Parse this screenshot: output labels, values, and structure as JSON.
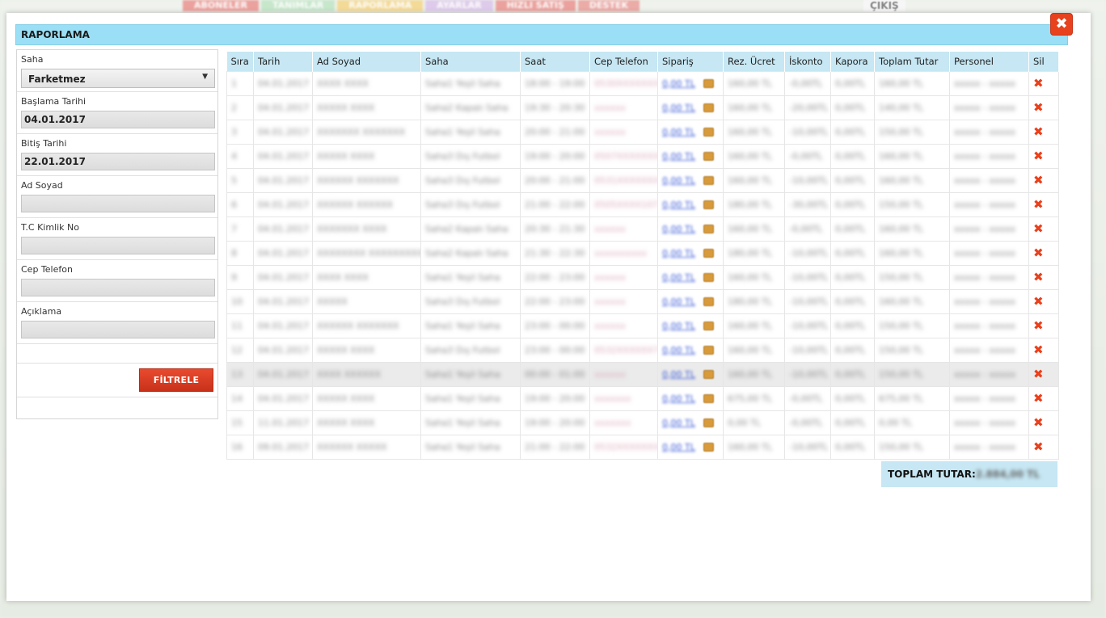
{
  "background_nav": {
    "items": [
      {
        "label": "ABONELER",
        "color": "#e05b56"
      },
      {
        "label": "TANIMLAR",
        "color": "#9fd7a8"
      },
      {
        "label": "RAPORLAMA",
        "color": "#f0c04a"
      },
      {
        "label": "AYARLAR",
        "color": "#c9a6e0"
      },
      {
        "label": "HIZLI SATIŞ",
        "color": "#e05b56"
      },
      {
        "label": "DESTEK",
        "color": "#e06b66"
      }
    ],
    "exit_label": "ÇIKIŞ"
  },
  "modal": {
    "title": "RAPORLAMA",
    "close_symbol": "✖"
  },
  "filters": {
    "saha_label": "Saha",
    "saha_value": "Farketmez",
    "start_label": "Başlama Tarihi",
    "start_value": "04.01.2017",
    "end_label": "Bitiş Tarihi",
    "end_value": "22.01.2017",
    "name_label": "Ad Soyad",
    "name_value": "",
    "tc_label": "T.C Kimlik No",
    "tc_value": "",
    "phone_label": "Cep Telefon",
    "phone_value": "",
    "note_label": "Açıklama",
    "note_value": "",
    "filter_button": "FİLTRELE"
  },
  "table": {
    "headers": [
      "Sıra",
      "Tarih",
      "Ad Soyad",
      "Saha",
      "Saat",
      "Cep Telefon",
      "Sipariş",
      "Rez. Ücret",
      "İskonto",
      "Kapora",
      "Toplam Tutar",
      "Personel",
      "Sil"
    ],
    "rows": [
      [
        "1",
        "04.01.2017",
        "XXXX XXXX",
        "Saha1 Yeşil Saha",
        "18:00 - 19:00",
        "0530XXXXXXX",
        "0,00 TL",
        "160,00 TL",
        "-0,00TL",
        "0,00TL",
        "160,00 TL",
        "xxxxx - xxxxx"
      ],
      [
        "2",
        "04.01.2017",
        "XXXXX XXXX",
        "Saha2 Kapalı Saha",
        "19:30 - 20:30",
        "xxxxxx",
        "0,00 TL",
        "160,00 TL",
        "-20,00TL",
        "0,00TL",
        "140,00 TL",
        "xxxxx - xxxxx"
      ],
      [
        "3",
        "04.01.2017",
        "XXXXXXX XXXXXXX",
        "Saha1 Yeşil Saha",
        "20:00 - 21:00",
        "xxxxxx",
        "0,00 TL",
        "160,00 TL",
        "-10,00TL",
        "0,00TL",
        "150,00 TL",
        "xxxxx - xxxxx"
      ],
      [
        "4",
        "04.01.2017",
        "XXXXX XXXX",
        "Saha3 Dış Futbol",
        "19:00 - 20:00",
        "0507XXXXXXX",
        "0,00 TL",
        "160,00 TL",
        "-0,00TL",
        "0,00TL",
        "160,00 TL",
        "xxxxx - xxxxx"
      ],
      [
        "5",
        "04.01.2017",
        "XXXXXX XXXXXXX",
        "Saha3 Dış Futbol",
        "20:00 - 21:00",
        "0531XXXXXXX",
        "0,00 TL",
        "160,00 TL",
        "-10,00TL",
        "0,00TL",
        "160,00 TL",
        "xxxxx - xxxxx"
      ],
      [
        "6",
        "04.01.2017",
        "XXXXXX XXXXXX",
        "Saha3 Dış Futbol",
        "21:00 - 22:00",
        "0505XXXX107",
        "0,00 TL",
        "180,00 TL",
        "-30,00TL",
        "0,00TL",
        "150,00 TL",
        "xxxxx - xxxxx"
      ],
      [
        "7",
        "04.01.2017",
        "XXXXXXX XXXX",
        "Saha2 Kapalı Saha",
        "20:30 - 21:30",
        "xxxxxx",
        "0,00 TL",
        "160,00 TL",
        "-0,00TL",
        "0,00TL",
        "160,00 TL",
        "xxxxx - xxxxx"
      ],
      [
        "8",
        "04.01.2017",
        "XXXXXXXX XXXXXXXXX",
        "Saha2 Kapalı Saha",
        "21:30 - 22:30",
        "xxxxxxxxxx",
        "0,00 TL",
        "180,00 TL",
        "-10,00TL",
        "0,00TL",
        "160,00 TL",
        "xxxxx - xxxxx"
      ],
      [
        "9",
        "04.01.2017",
        "XXXX XXXX",
        "Saha1 Yeşil Saha",
        "22:00 - 23:00",
        "xxxxxx",
        "0,00 TL",
        "160,00 TL",
        "-10,00TL",
        "0,00TL",
        "150,00 TL",
        "xxxxx - xxxxx"
      ],
      [
        "10",
        "04.01.2017",
        "XXXXX",
        "Saha3 Dış Futbol",
        "22:00 - 23:00",
        "xxxxxx",
        "0,00 TL",
        "180,00 TL",
        "-10,00TL",
        "0,00TL",
        "160,00 TL",
        "xxxxx - xxxxx"
      ],
      [
        "11",
        "04.01.2017",
        "XXXXXX XXXXXXX",
        "Saha1 Yeşil Saha",
        "23:00 - 00:00",
        "xxxxxx",
        "0,00 TL",
        "160,00 TL",
        "-10,00TL",
        "0,00TL",
        "150,00 TL",
        "xxxxx - xxxxx"
      ],
      [
        "12",
        "04.01.2017",
        "XXXXX XXXX",
        "Saha3 Dış Futbol",
        "23:00 - 00:00",
        "0532XXXXXX7",
        "0,00 TL",
        "160,00 TL",
        "-10,00TL",
        "0,00TL",
        "150,00 TL",
        "xxxxx - xxxxx"
      ],
      [
        "13",
        "04.01.2017",
        "XXXX XXXXXX",
        "Saha1 Yeşil Saha",
        "00:00 - 01:00",
        "xxxxxx",
        "0,00 TL",
        "160,00 TL",
        "-10,00TL",
        "0,00TL",
        "150,00 TL",
        "xxxxx - xxxxx"
      ],
      [
        "14",
        "04.01.2017",
        "XXXXX XXXX",
        "Saha1 Yeşil Saha",
        "19:00 - 20:00",
        "xxxxxxx",
        "0,00 TL",
        "675,00 TL",
        "-0,00TL",
        "0,00TL",
        "675,00 TL",
        "xxxxx - xxxxx"
      ],
      [
        "15",
        "11.01.2017",
        "XXXXX XXXX",
        "Saha1 Yeşil Saha",
        "19:00 - 20:00",
        "xxxxxxx",
        "0,00 TL",
        "0,00 TL",
        "-0,00TL",
        "0,00TL",
        "0,00 TL",
        "xxxxx - xxxxx"
      ],
      [
        "16",
        "09.01.2017",
        "XXXXXX XXXXX",
        "Saha1 Yeşil Saha",
        "21:00 - 22:00",
        "0532XXXXXXX",
        "0,00 TL",
        "160,00 TL",
        "-10,00TL",
        "0,00TL",
        "150,00 TL",
        "xxxxx - xxxxx"
      ]
    ],
    "delete_symbol": "✖"
  },
  "total": {
    "label": "TOPLAM TUTAR:",
    "value": "2.884,00 TL"
  },
  "colors": {
    "title_bar": "#9adff5",
    "header_bg": "#c6e7f3",
    "accent_red": "#e8411d"
  }
}
